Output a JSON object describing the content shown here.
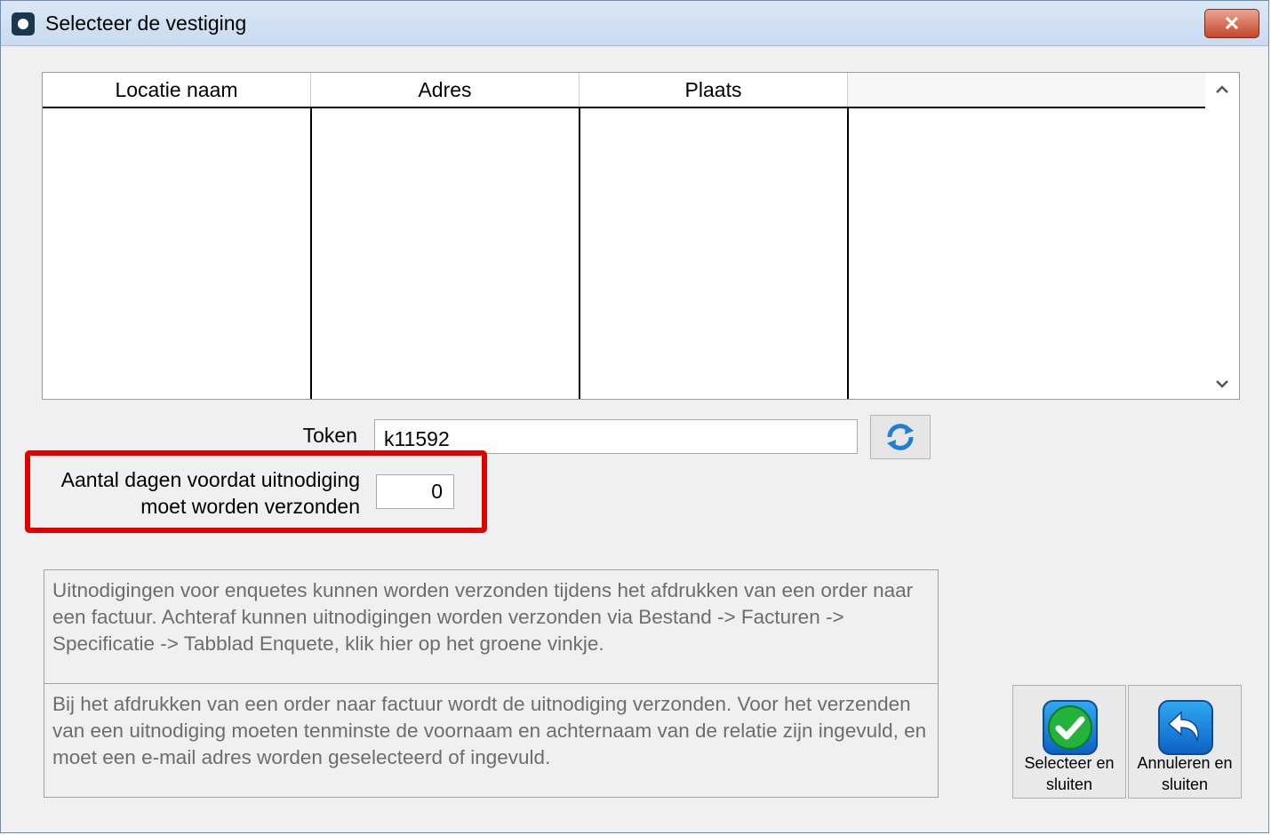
{
  "window": {
    "title": "Selecteer de vestiging",
    "close_label": "✕"
  },
  "grid": {
    "columns": [
      "Locatie naam",
      "Adres",
      "Plaats"
    ],
    "rows": []
  },
  "token": {
    "label": "Token",
    "value": "k11592"
  },
  "days": {
    "label": "Aantal dagen voordat uitnodiging moet worden verzonden",
    "value": "0"
  },
  "info": {
    "text1": "Uitnodigingen voor enquetes kunnen worden verzonden tijdens het afdrukken van een order naar een factuur. Achteraf kunnen uitnodigingen worden verzonden via Bestand -> Facturen -> Specificatie -> Tabblad Enquete, klik hier op het groene vinkje.",
    "text2": "Bij het afdrukken van een order naar factuur wordt de uitnodiging verzonden. Voor het verzenden van een uitnodiging moeten tenminste de voornaam en achternaam van de relatie zijn ingevuld, en moet een e-mail adres worden geselecteerd of ingevuld."
  },
  "buttons": {
    "select_label": "Selecteer en sluiten",
    "cancel_label": "Annuleren en sluiten"
  },
  "icons": {
    "app": "app-icon",
    "refresh": "refresh-icon",
    "check": "checkmark-icon",
    "cancel": "undo-arrow-icon"
  },
  "colors": {
    "highlight": "#e00000",
    "titlebar": "#c9dbef",
    "check_green": "#1fa52a",
    "icon_blue": "#0d62c5"
  }
}
